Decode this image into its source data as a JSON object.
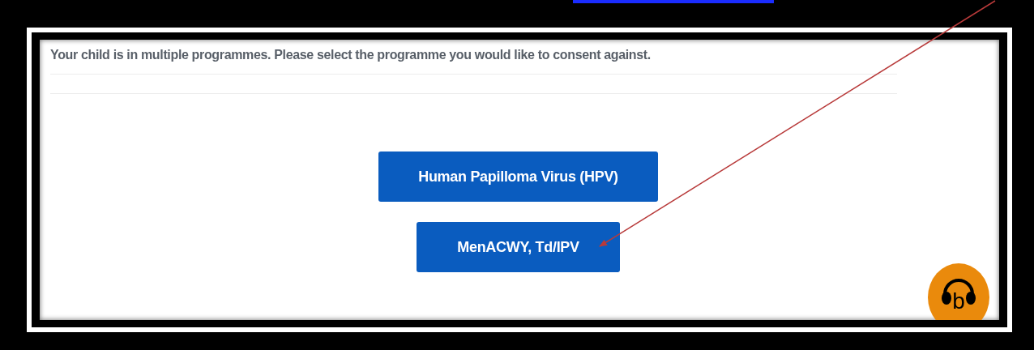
{
  "message": "Your child is in multiple programmes. Please select the programme you would like to consent against.",
  "programmes": [
    {
      "label": "Human Papilloma Virus (HPV)"
    },
    {
      "label": "MenACWY, Td/IPV"
    }
  ],
  "audio_button": {
    "letter": "b"
  }
}
